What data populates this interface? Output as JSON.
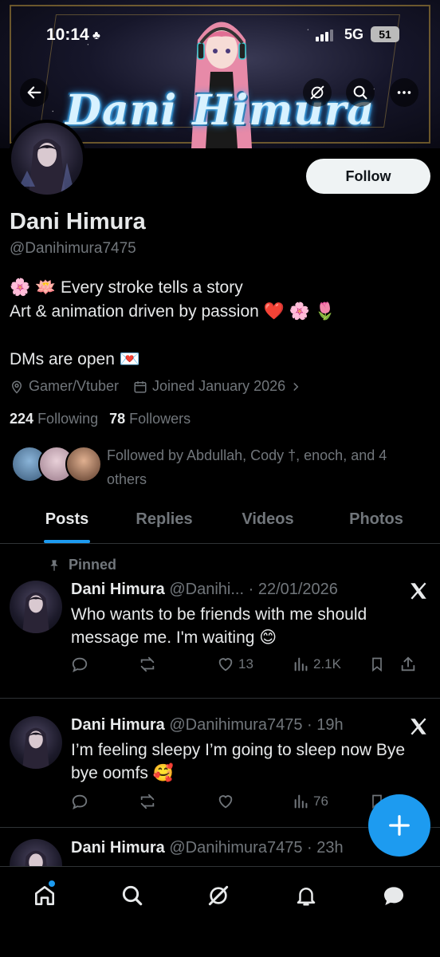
{
  "status_bar": {
    "time": "10:14",
    "network": "5G",
    "battery": "51"
  },
  "banner": {
    "title": "Dani Himura"
  },
  "profile": {
    "display_name": "Dani Himura",
    "handle": "@Danihimura7475",
    "bio_line1": "🌸 🪷 Every stroke tells a story",
    "bio_line2": "Art & animation driven by passion ❤️ 🌸 🌷",
    "bio_line3": "DMs are open 💌",
    "location": "Gamer/Vtuber",
    "joined": "Joined January 2026",
    "following_count": "224",
    "following_label": "Following",
    "followers_count": "78",
    "followers_label": "Followers",
    "followed_by": "Followed by Abdullah, Cody †,  enoch, and 4 others",
    "follow_button": "Follow"
  },
  "tabs": [
    {
      "label": "Posts",
      "active": true
    },
    {
      "label": "Replies",
      "active": false
    },
    {
      "label": "Videos",
      "active": false
    },
    {
      "label": "Photos",
      "active": false
    }
  ],
  "posts": [
    {
      "pinned_label": "Pinned",
      "name": "Dani Himura",
      "handle_date": "@Danihi... · 22/01/2026",
      "text": "Who wants to be friends with me should message me. I'm waiting 😊",
      "likes": "13",
      "views": "2.1K"
    },
    {
      "name": "Dani Himura",
      "handle_date": "@Danihimura7475 · 19h",
      "text": "I’m feeling sleepy I’m going to sleep now Bye bye oomfs 🥰",
      "likes": "",
      "views": "76"
    },
    {
      "name": "Dani Himura",
      "handle_date": "@Danihimura7475 · 23h"
    }
  ],
  "icons": {
    "back": "back-arrow-icon",
    "grok": "grok-icon",
    "search": "search-icon",
    "more": "more-icon",
    "location": "location-icon",
    "calendar": "calendar-icon",
    "reply": "reply-icon",
    "repost": "repost-icon",
    "like": "like-icon",
    "views": "views-icon",
    "bookmark": "bookmark-icon",
    "share": "share-icon",
    "compose": "compose-plus-icon",
    "home": "home-icon",
    "notifications": "bell-icon",
    "messages": "messages-icon"
  },
  "colors": {
    "accent": "#1d9bf0",
    "background": "#000000",
    "secondary_text": "#71767b"
  }
}
